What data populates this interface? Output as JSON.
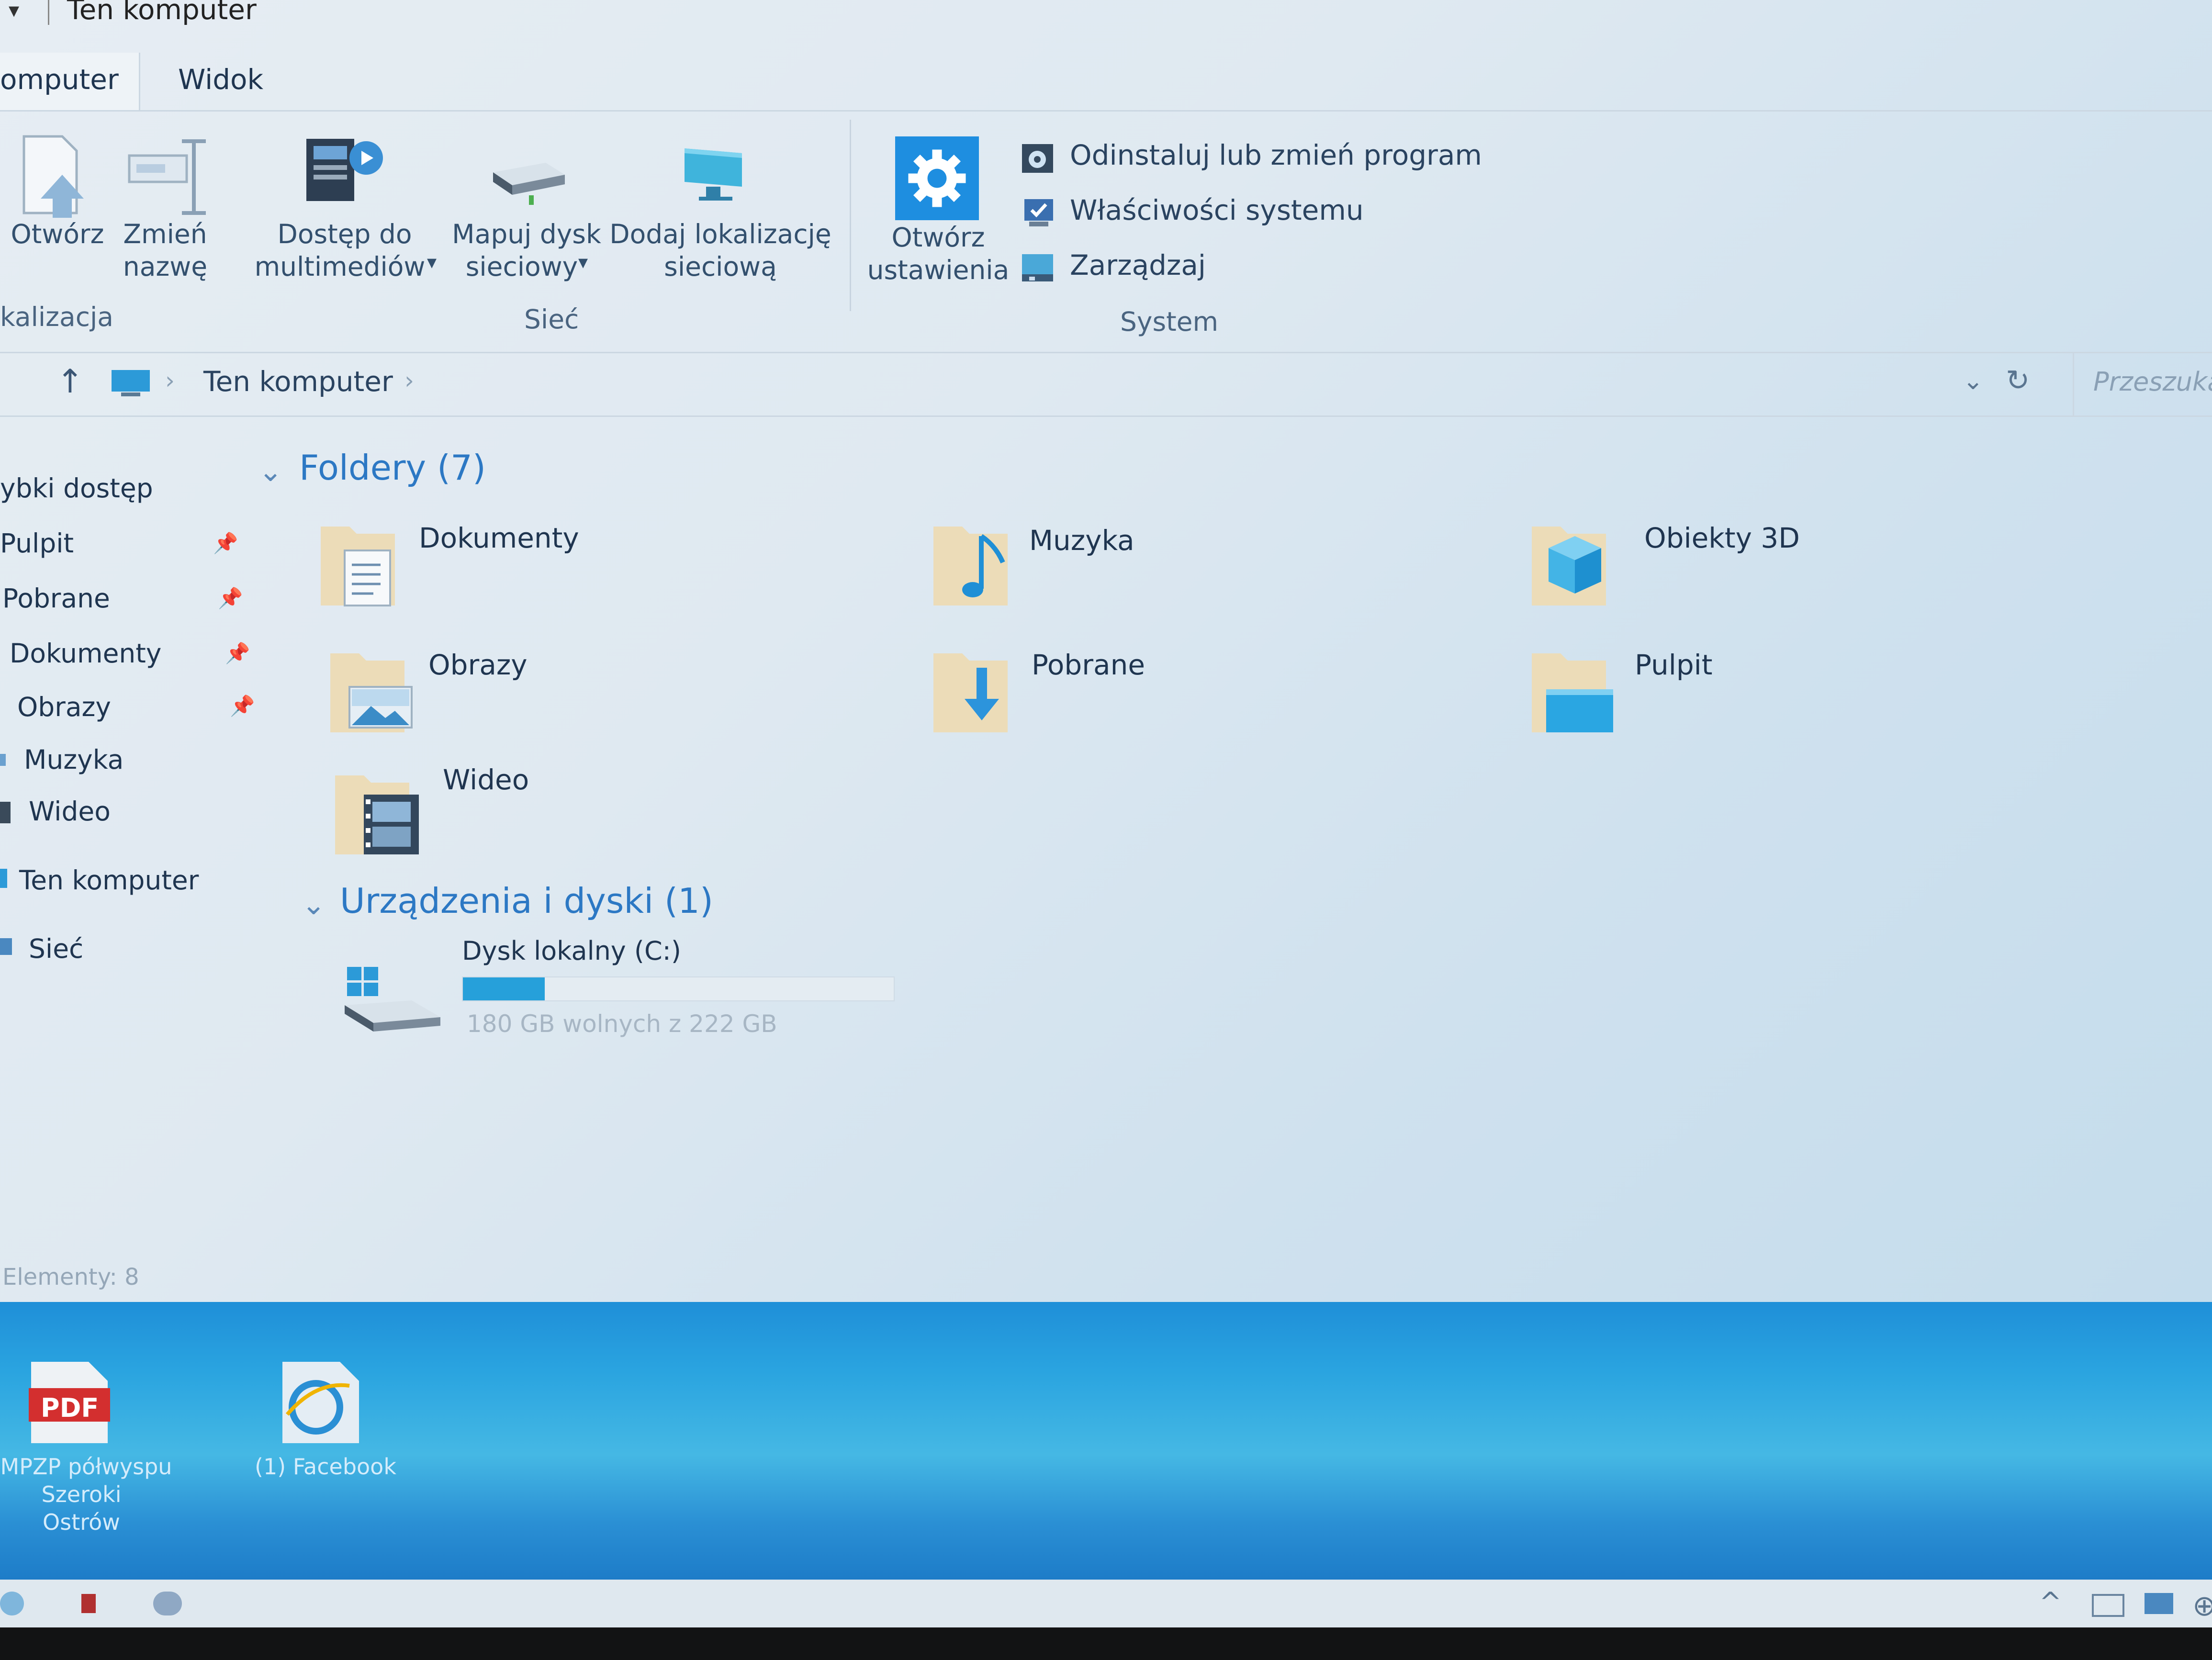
{
  "window": {
    "title": "Ten komputer"
  },
  "tabs": [
    {
      "label": "omputer"
    },
    {
      "label": "Widok"
    }
  ],
  "ribbon": {
    "open": "Otwórz",
    "rename_1": "Zmień",
    "rename_2": "nazwę",
    "media_1": "Dostęp do",
    "media_2": "multimediów",
    "mapdrive_1": "Mapuj dysk",
    "mapdrive_2": "sieciowy",
    "addloc_1": "Dodaj lokalizację",
    "addloc_2": "sieciową",
    "settings_1": "Otwórz",
    "settings_2": "ustawienia",
    "uninstall": "Odinstaluj lub zmień program",
    "sysprops": "Właściwości systemu",
    "manage": "Zarządzaj",
    "group_location": "kalizacja",
    "group_network": "Sieć",
    "group_system": "System"
  },
  "address": {
    "path": "Ten komputer",
    "search_placeholder": "Przeszuka"
  },
  "nav": {
    "quick_access": "ybki dostęp",
    "items": [
      "Pulpit",
      "Pobrane",
      "Dokumenty",
      "Obrazy",
      "Muzyka",
      "Wideo"
    ],
    "this_pc": "Ten komputer",
    "network": "Sieć"
  },
  "content": {
    "folders_header": "Foldery (7)",
    "folders": [
      "Dokumenty",
      "Muzyka",
      "Obiekty 3D",
      "Obrazy",
      "Pobrane",
      "Pulpit",
      "Wideo"
    ],
    "devices_header": "Urządzenia i dyski (1)",
    "drive": {
      "name": "Dysk lokalny (C:)",
      "free_text": "180 GB wolnych z 222 GB",
      "used_fraction": 0.19
    }
  },
  "status": {
    "items_text": "Elementy: 8"
  },
  "desktop": {
    "pdf_badge": "PDF",
    "pdf_label_1": "MPZP półwyspu",
    "pdf_label_2": "Szeroki Ostrów",
    "fb_label": "(1) Facebook"
  },
  "colors": {
    "accent": "#2c78c4",
    "drive_bar": "#26a0da",
    "desktop": "#2aa4e0"
  }
}
